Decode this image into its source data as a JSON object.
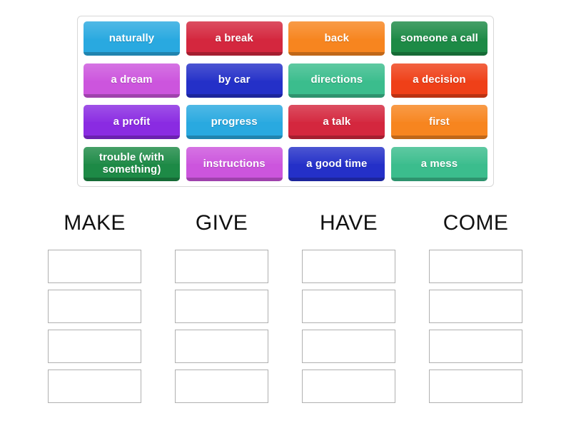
{
  "activity": {
    "type": "group-sort",
    "tile_pool": {
      "rows": [
        [
          {
            "label": "naturally",
            "color": "#29a9e0"
          },
          {
            "label": "a break",
            "color": "#d4273e"
          },
          {
            "label": "back",
            "color": "#f7851f"
          },
          {
            "label": "someone a call",
            "color": "#1d8a46"
          }
        ],
        [
          {
            "label": "a dream",
            "color": "#cc55dd"
          },
          {
            "label": "by car",
            "color": "#2430c8"
          },
          {
            "label": "directions",
            "color": "#3bbd8d"
          },
          {
            "label": "a decision",
            "color": "#ef4018"
          }
        ],
        [
          {
            "label": "a profit",
            "color": "#8a2be2"
          },
          {
            "label": "progress",
            "color": "#29a9e0"
          },
          {
            "label": "a talk",
            "color": "#d4273e"
          },
          {
            "label": "first",
            "color": "#f7851f"
          }
        ],
        [
          {
            "label": "trouble (with something)",
            "color": "#1d8a46"
          },
          {
            "label": "instructions",
            "color": "#cc55dd"
          },
          {
            "label": "a good time",
            "color": "#2430c8"
          },
          {
            "label": "a mess",
            "color": "#3bbd8d"
          }
        ]
      ]
    },
    "categories": [
      {
        "title": "MAKE",
        "slots": [
          "",
          "",
          "",
          ""
        ]
      },
      {
        "title": "GIVE",
        "slots": [
          "",
          "",
          "",
          ""
        ]
      },
      {
        "title": "HAVE",
        "slots": [
          "",
          "",
          "",
          ""
        ]
      },
      {
        "title": "COME",
        "slots": [
          "",
          "",
          "",
          ""
        ]
      }
    ],
    "colors": {
      "panel_border": "#d7d7d7",
      "slot_border": "#b0b0b0",
      "background": "#ffffff",
      "title_text": "#111111",
      "tile_text": "#ffffff"
    }
  }
}
